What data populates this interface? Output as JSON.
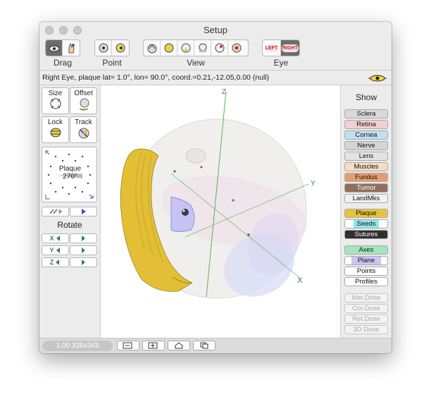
{
  "window": {
    "title": "Setup"
  },
  "toolbar": {
    "drag_label": "Drag",
    "point_label": "Point",
    "view_label": "View",
    "eye_label": "Eye",
    "eye_left": "LEFT",
    "eye_right": "RIGHT"
  },
  "status": {
    "text": "Right Eye, plaque lat=  1.0°, lon= 90.0°, coord.=0.21,-12.05,0.00  (null)"
  },
  "left_panel": {
    "size": "Size",
    "offset": "Offset",
    "lock": "Lock",
    "track": "Track",
    "plaque": "Plaque",
    "angle": "270°",
    "rotate": "Rotate",
    "axes": [
      "X",
      "Y",
      "Z"
    ]
  },
  "viewport": {
    "axis_labels": [
      "Z",
      "Y",
      "X"
    ]
  },
  "right_panel": {
    "show": "Show",
    "buttons": [
      {
        "label": "Sclera",
        "color": "#d9d9d9"
      },
      {
        "label": "Retina",
        "color": "#f3cfcf"
      },
      {
        "label": "Cornea",
        "color": "#bfe0f0"
      },
      {
        "label": "Nerve",
        "color": "#d4d4d4"
      },
      {
        "label": "Lens",
        "color": "#e3e3e3"
      },
      {
        "label": "Muscles",
        "color": "#f6dcc2"
      },
      {
        "label": "Fundus",
        "color": "#e79c6f"
      },
      {
        "label": "Tumor",
        "color": "#8f6f5f"
      },
      {
        "label": "LandMks",
        "color": "#f1f1f1"
      },
      {
        "label": "Plaque",
        "color": "#e7c33a"
      },
      {
        "label": "Seeds",
        "color": "#90e6ee"
      },
      {
        "label": "Sutures",
        "color": "#2f2f2f"
      },
      {
        "label": "Axes",
        "color": "#a4e6bc"
      },
      {
        "label": "Plane",
        "color": "#cbc6f5"
      },
      {
        "label": "Points",
        "color": "#ffffff"
      },
      {
        "label": "Profiles",
        "color": "#ffffff"
      },
      {
        "label": "Mer.Dose",
        "color": "#f3f3f3"
      },
      {
        "label": "Cor.Dose",
        "color": "#f3f3f3"
      },
      {
        "label": "Ret.Dose",
        "color": "#f3f3f3"
      },
      {
        "label": "3D Dose",
        "color": "#f3f3f3"
      }
    ]
  },
  "bottom": {
    "zoom_text": "1.00 326x343"
  }
}
